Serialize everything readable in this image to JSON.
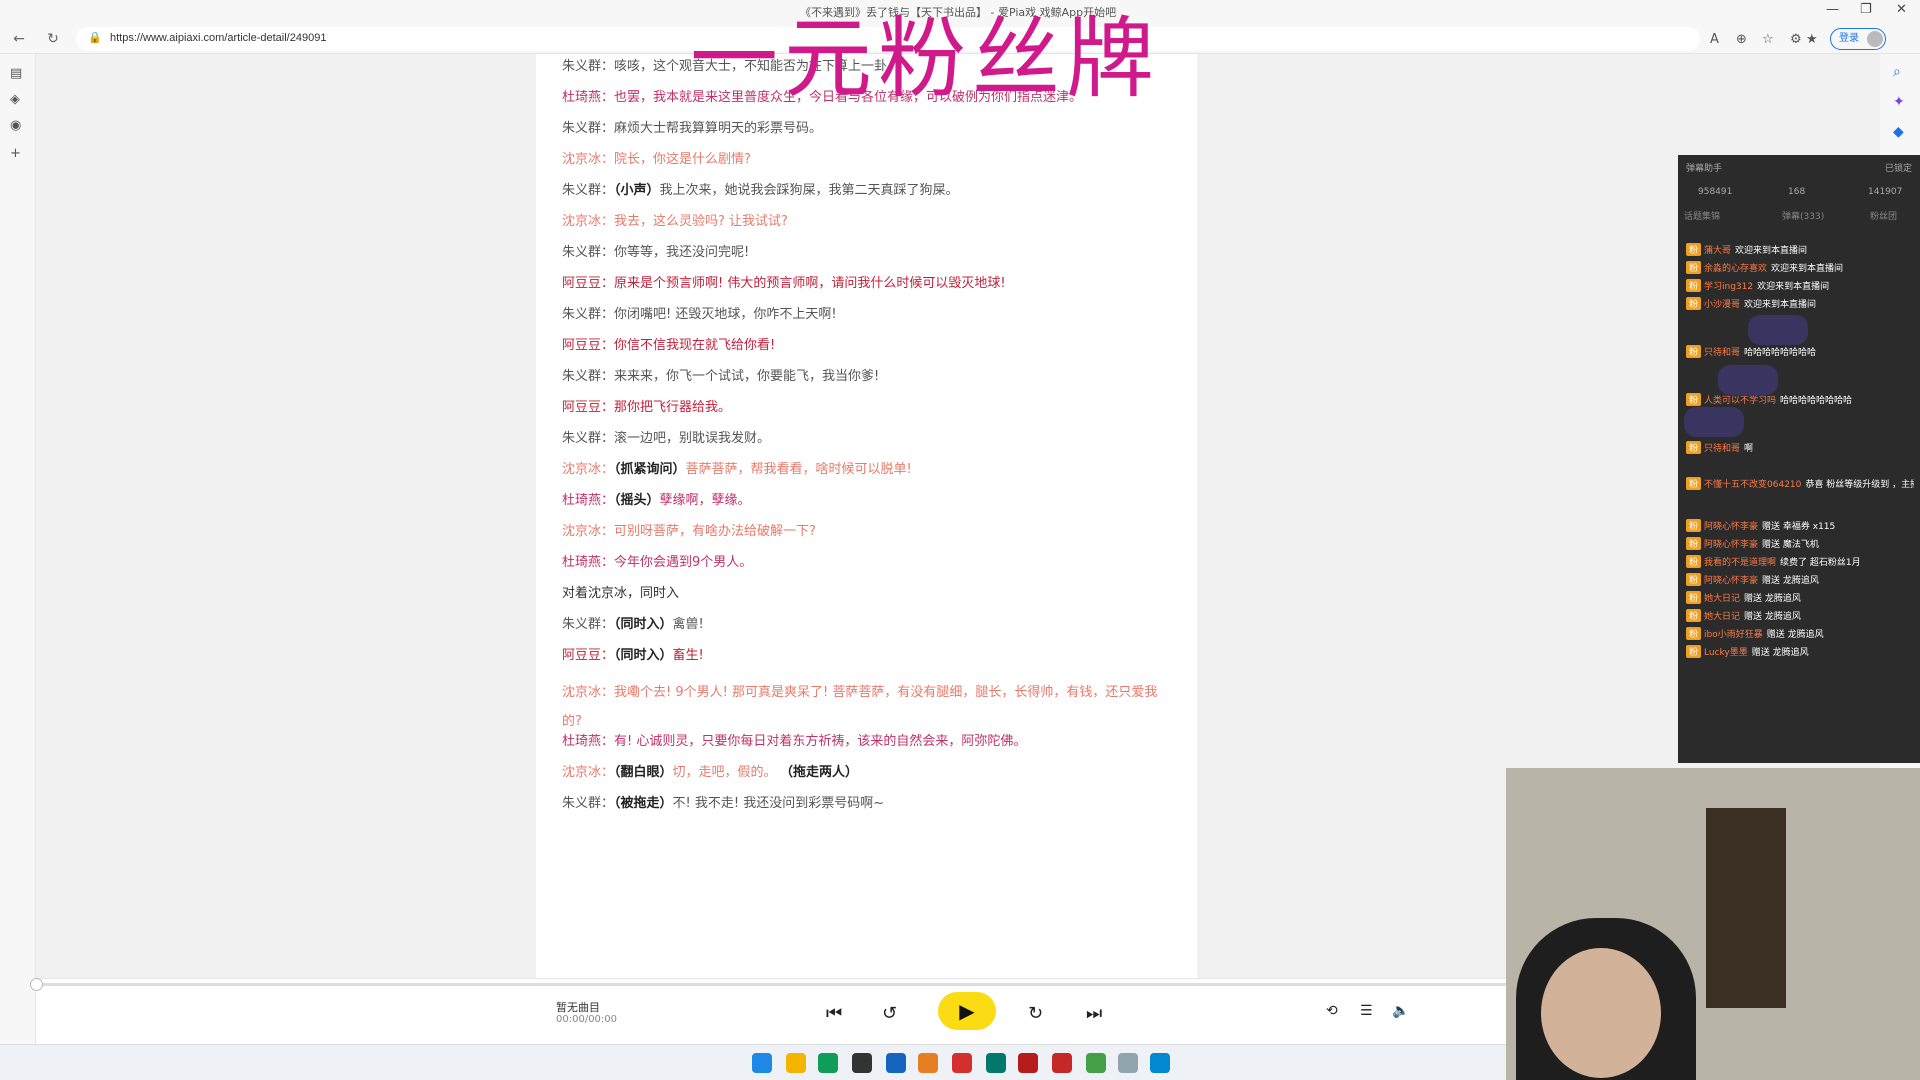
{
  "window": {
    "title": "《不来遇到》丢了钱与【天下书出品】 - 爱Pia戏 戏鲸App开始吧",
    "controls": [
      "—",
      "❐",
      "✕"
    ]
  },
  "browser": {
    "url": "https://www.aipiaxi.com/article-detail/249091",
    "login_label": "登录",
    "icons": [
      "back-icon",
      "refresh-icon",
      "lock-icon"
    ]
  },
  "watermark": "一元粉丝牌",
  "script_lines": [
    {
      "speaker": "朱义群：",
      "action": "",
      "text": "咳咳，这个观音大士，不知能否为在下算上一卦",
      "cls": "c-zhu"
    },
    {
      "speaker": "杜琦燕：",
      "action": "",
      "text": "也罢，我本就是来这里普度众生，今日看与各位有缘，可以破例为你们指点迷津。",
      "cls": "c-du"
    },
    {
      "speaker": "朱义群：",
      "action": "",
      "text": "麻烦大士帮我算算明天的彩票号码。",
      "cls": "c-zhu"
    },
    {
      "speaker": "沈京冰：",
      "action": "",
      "text": "院长，你这是什么剧情?",
      "cls": "c-shen"
    },
    {
      "speaker": "朱义群：",
      "action": "（小声）",
      "text": "我上次来，她说我会踩狗屎，我第二天真踩了狗屎。",
      "cls": "c-zhu"
    },
    {
      "speaker": "沈京冰：",
      "action": "",
      "text": "我去，这么灵验吗? 让我试试?",
      "cls": "c-shen"
    },
    {
      "speaker": "朱义群：",
      "action": "",
      "text": "你等等，我还没问完呢!",
      "cls": "c-zhu"
    },
    {
      "speaker": "阿豆豆：",
      "action": "",
      "text": "原来是个预言师啊! 伟大的预言师啊，请问我什么时候可以毁灭地球!",
      "cls": "c-a"
    },
    {
      "speaker": "朱义群：",
      "action": "",
      "text": "你闭嘴吧! 还毁灭地球，你咋不上天啊!",
      "cls": "c-zhu"
    },
    {
      "speaker": "阿豆豆：",
      "action": "",
      "text": "你信不信我现在就飞给你看!",
      "cls": "c-a"
    },
    {
      "speaker": "朱义群：",
      "action": "",
      "text": "来来来，你飞一个试试，你要能飞，我当你爹!",
      "cls": "c-zhu"
    },
    {
      "speaker": "阿豆豆：",
      "action": "",
      "text": "那你把飞行器给我。",
      "cls": "c-a"
    },
    {
      "speaker": "朱义群：",
      "action": "",
      "text": "滚一边吧，别耽误我发财。",
      "cls": "c-zhu"
    },
    {
      "speaker": "沈京冰：",
      "action": "（抓紧询问）",
      "text": "菩萨菩萨，帮我看看，啥时候可以脱单!",
      "cls": "c-shen"
    },
    {
      "speaker": "杜琦燕：",
      "action": "（摇头）",
      "text": "孽缘啊，孽缘。",
      "cls": "c-du"
    },
    {
      "speaker": "沈京冰：",
      "action": "",
      "text": "可别呀菩萨，有啥办法给破解一下?",
      "cls": "c-shen"
    },
    {
      "speaker": "杜琦燕：",
      "action": "",
      "text": "今年你会遇到9个男人。",
      "cls": "c-du"
    },
    {
      "speaker": "",
      "action": "",
      "text": "对着沈京冰，同时入",
      "cls": "c-plain"
    },
    {
      "speaker": "朱义群：",
      "action": "（同时入）",
      "text": "禽兽!",
      "cls": "c-zhu"
    },
    {
      "speaker": "阿豆豆：",
      "action": "（同时入）",
      "text": "畜生!",
      "cls": "c-a"
    },
    {
      "speaker": "沈京冰：",
      "action": "",
      "text": "我嘞个去! 9个男人! 那可真是爽呆了! 菩萨菩萨，有没有腿细，腿长，长得帅，有钱，还只爱我的?",
      "cls": "c-shen"
    },
    {
      "speaker": "杜琦燕：",
      "action": "",
      "text": "有! 心诚则灵，只要你每日对着东方祈祷，该来的自然会来，阿弥陀佛。",
      "cls": "c-du"
    },
    {
      "speaker": "沈京冰：",
      "action": "（翻白眼）",
      "text": "切，走吧，假的。",
      "tail": "（拖走两人）",
      "cls": "c-shen"
    },
    {
      "speaker": "朱义群：",
      "action": "（被拖走）",
      "text": "不! 我不走! 我还没问到彩票号码啊~",
      "cls": "c-zhu"
    }
  ],
  "player": {
    "title": "暂无曲目",
    "time": "00:00/00:00"
  },
  "chat": {
    "header": "弹幕助手",
    "header_right": "已锁定",
    "stats": [
      "958491",
      "168",
      "141907"
    ],
    "tabs": [
      "话题集锦",
      "弹幕(333)",
      "粉丝团"
    ],
    "messages": [
      {
        "name": "蒲大哥",
        "text": "欢迎来到本直播间"
      },
      {
        "name": "余淼的心存喜欢",
        "text": "欢迎来到本直播间"
      },
      {
        "name": "学习ing312",
        "text": "欢迎来到本直播间"
      },
      {
        "name": "小沙漫哥",
        "text": "欢迎来到本直播间"
      },
      {
        "name": "只待和哥",
        "text": "哈哈哈哈哈哈哈哈"
      },
      {
        "name": "人类可以不学习吗",
        "text": "哈哈哈哈哈哈哈哈"
      },
      {
        "name": "只待和哥",
        "text": "啊"
      },
      {
        "name": "不懂十五不改变064210",
        "text": "恭喜 粉丝等级升级到 ，主播更爱你哟"
      },
      {
        "name": "阿晓心怀李豪",
        "text": "赠送 幸福券 x115"
      },
      {
        "name": "阿晓心怀李豪",
        "text": "赠送 魔法飞机"
      },
      {
        "name": "我看的不是道理啊",
        "text": "续费了 超石粉丝1月"
      },
      {
        "name": "阿晓心怀李豪",
        "text": "赠送 龙腾追风"
      },
      {
        "name": "她大日记",
        "text": "赠送 龙腾追风"
      },
      {
        "name": "她大日记",
        "text": "赠送 龙腾追风"
      },
      {
        "name": "ibo小雨好狂暴",
        "text": "赠送 龙腾追风"
      },
      {
        "name": "Lucky墨墨",
        "text": "赠送 龙腾追风"
      }
    ]
  }
}
